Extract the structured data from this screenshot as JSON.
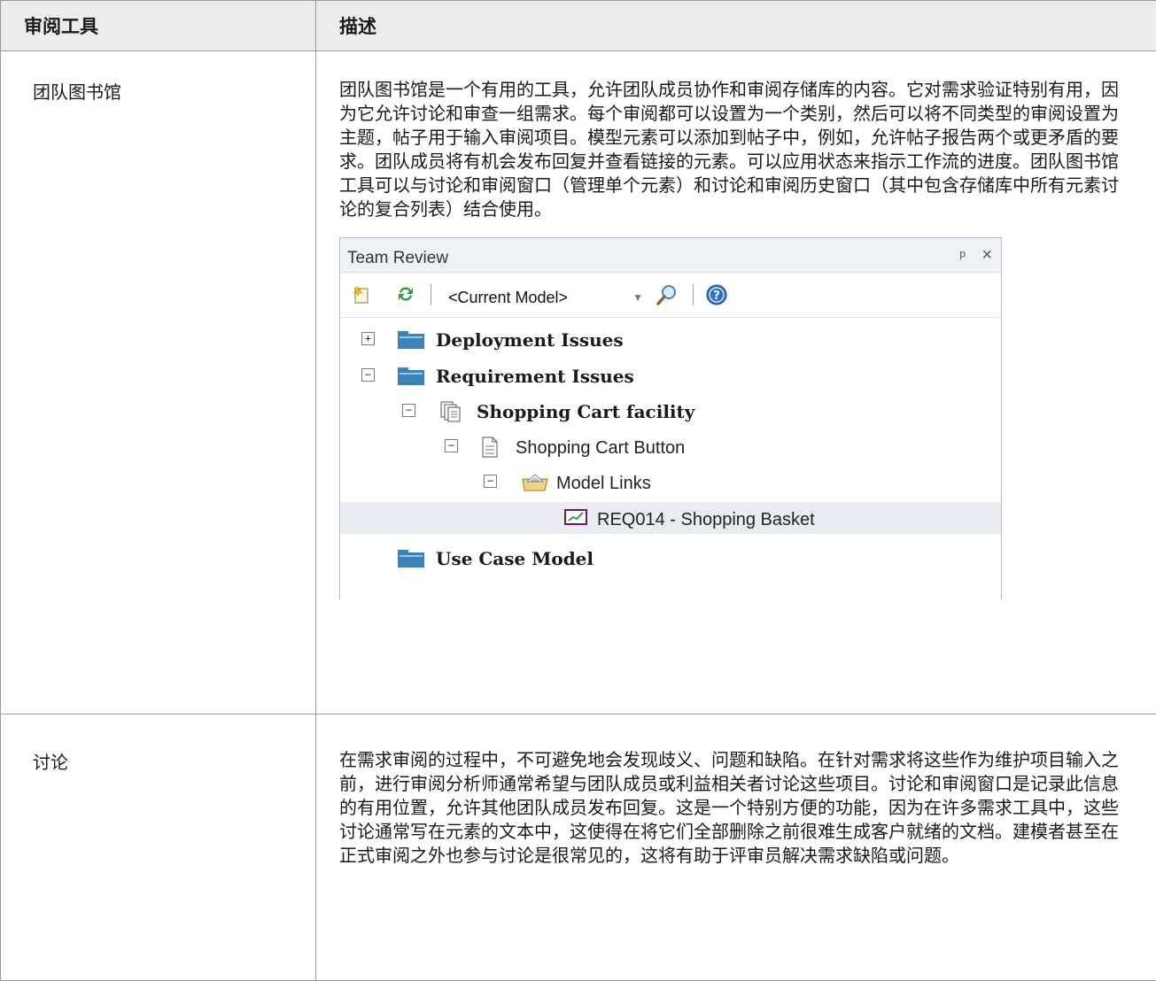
{
  "table": {
    "header": {
      "col1": "审阅工具",
      "col2": "描述"
    },
    "rows": [
      {
        "tool": "团队图书馆",
        "description": "团队图书馆是一个有用的工具，允许团队成员协作和审阅存储库的内容。它对需求验证特别有用，因为它允许讨论和审查一组需求。每个审阅都可以设置为一个类别，然后可以将不同类型的审阅设置为主题，帖子用于输入审阅项目。模型元素可以添加到帖子中，例如，允许帖子报告两个或更矛盾的要求。团队成员将有机会发布回复并查看链接的元素。可以应用状态来指示工作流的进度。团队图书馆工具可以与讨论和审阅窗口（管理单个元素）和讨论和审阅历史窗口（其中包含存储库中所有元素讨论的复合列表）结合使用。"
      },
      {
        "tool": "讨论",
        "description": "在需求审阅的过程中，不可避免地会发现歧义、问题和缺陷。在针对需求将这些作为维护项目输入之前，进行审阅分析师通常希望与团队成员或利益相关者讨论这些项目。讨论和审阅窗口是记录此信息的有用位置，允许其他团队成员发布回复。这是一个特别方便的功能，因为在许多需求工具中，这些讨论通常写在元素的文本中，这使得在将它们全部删除之前很难生成客户就绪的文档。建模者甚至在正式审阅之外也参与讨论是很常见的，这将有助于评审员解决需求缺陷或问题。"
      }
    ]
  },
  "team_review": {
    "title": "Team Review",
    "pin_glyph": "ᵖ",
    "close_glyph": "×",
    "combo_value": "<Current Model>",
    "tree": [
      {
        "label": "Deployment Issues",
        "expander": "+"
      },
      {
        "label": "Requirement Issues",
        "expander": "−"
      },
      {
        "label": "Shopping Cart facility",
        "expander": "−"
      },
      {
        "label": "Shopping Cart Button",
        "expander": "−"
      },
      {
        "label": "Model Links",
        "expander": "−"
      },
      {
        "label": "REQ014 - Shopping Basket"
      },
      {
        "label": "Use Case Model"
      }
    ],
    "colors": {
      "folder": "#3b82b6",
      "refresh_green": "#2e9e3e",
      "help_blue": "#2f6fd0"
    }
  }
}
